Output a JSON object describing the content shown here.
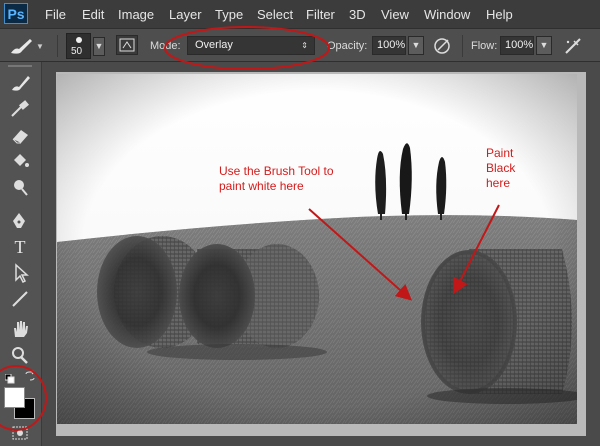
{
  "menubar": {
    "logo": "Ps",
    "items": [
      "File",
      "Edit",
      "Image",
      "Layer",
      "Type",
      "Select",
      "Filter",
      "3D",
      "View",
      "Window",
      "Help"
    ]
  },
  "options": {
    "brush_size": "50",
    "mode_label": "Mode:",
    "mode_value": "Overlay",
    "opacity_label": "Opacity:",
    "opacity_value": "100%",
    "flow_label": "Flow:",
    "flow_value": "100%"
  },
  "annotations": {
    "white_text": "Use the Brush Tool to\npaint white here",
    "black_text": "Paint\nBlack\nhere"
  },
  "tools": [
    "brush-tool-icon",
    "healing-brush-icon",
    "eraser-icon",
    "paint-bucket-icon",
    "dodge-icon",
    "pen-icon",
    "type-icon",
    "path-selection-icon",
    "line-icon",
    "hand-icon",
    "zoom-icon"
  ],
  "colors": {
    "foreground": "#ffffff",
    "background": "#000000",
    "highlight_red": "#d41c1c"
  }
}
